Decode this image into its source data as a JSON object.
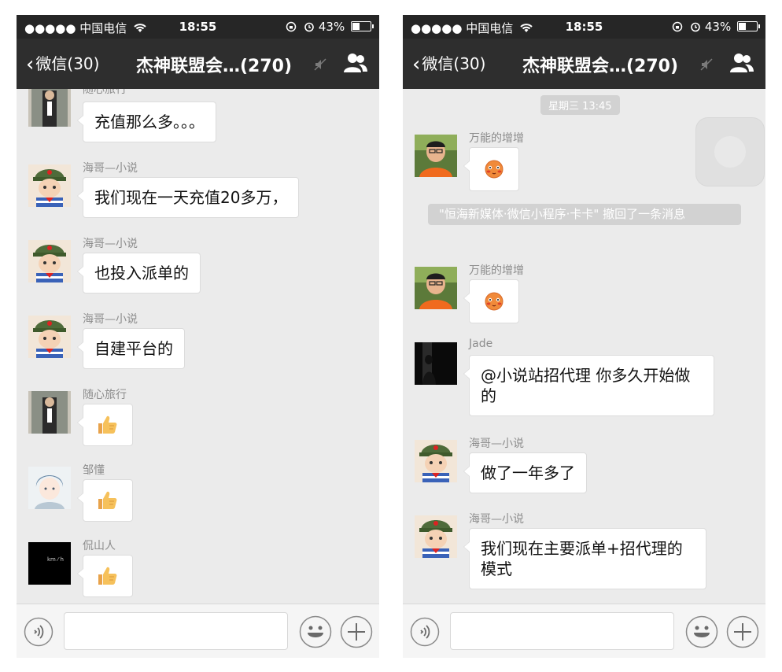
{
  "left": {
    "status": {
      "carrier": "●●●●● 中国电信",
      "time": "18:55",
      "battery_text": "43%",
      "battery_level": 0.43
    },
    "nav": {
      "back_label": "微信(30)",
      "title": "杰神联盟会…(270)"
    },
    "messages": [
      {
        "sender": "随心旅行",
        "text": "充值那么多。。。"
      },
      {
        "sender": "海哥—小说",
        "text": "我们现在一天充值20多万，"
      },
      {
        "sender": "海哥—小说",
        "text": "也投入派单的"
      },
      {
        "sender": "海哥—小说",
        "text": "自建平台的"
      },
      {
        "sender": "随心旅行",
        "emoji": "thumbs-up"
      },
      {
        "sender": "邹懂",
        "emoji": "thumbs-up"
      },
      {
        "sender": "侃山人",
        "emoji": "thumbs-up",
        "avatar_text": "km ⁄ h"
      }
    ]
  },
  "right": {
    "status": {
      "carrier": "●●●●● 中国电信",
      "time": "18:55",
      "battery_text": "43%",
      "battery_level": 0.43
    },
    "nav": {
      "back_label": "微信(30)",
      "title": "杰神联盟会…(270)"
    },
    "timestamp": "星期三 13:45",
    "system_notice": "\"恒海新媒体·微信小程序·卡卡\" 撤回了一条消息",
    "messages": [
      {
        "sender": "万能的增增",
        "emoji": "blush-face"
      },
      {
        "sender": "万能的增增",
        "emoji": "blush-face"
      },
      {
        "sender": "Jade",
        "text": "@小说站招代理 你多久开始做的"
      },
      {
        "sender": "海哥—小说",
        "text": "做了一年多了"
      },
      {
        "sender": "海哥—小说",
        "text": "我们现在主要派单+招代理的模式"
      }
    ]
  },
  "colors": {
    "statusbar": "#262626",
    "navbar": "#2e2e2e",
    "chat_bg": "#ebebeb",
    "bubble": "#ffffff",
    "pill": "#d2d2d2"
  },
  "icons": [
    "wifi-icon",
    "lock-rotation-icon",
    "alarm-icon",
    "battery-icon",
    "back-chevron-icon",
    "mute-icon",
    "group-members-icon",
    "voice-icon",
    "emoji-face-icon",
    "plus-icon",
    "thumbs-up-icon",
    "blush-face-icon"
  ]
}
